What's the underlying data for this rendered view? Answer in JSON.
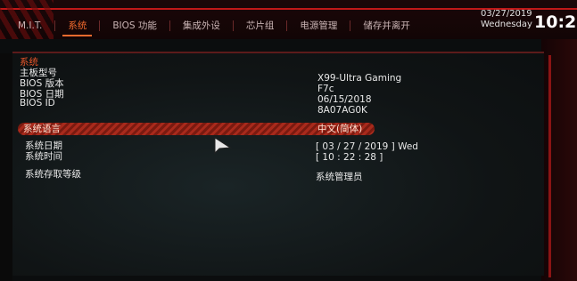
{
  "tabs": [
    {
      "label": "M.I.T."
    },
    {
      "label": "系统"
    },
    {
      "label": "BIOS 功能"
    },
    {
      "label": "集成外设"
    },
    {
      "label": "芯片组"
    },
    {
      "label": "电源管理"
    },
    {
      "label": "储存并离开"
    }
  ],
  "clock": {
    "date": "03/27/2019",
    "day": "Wednesday",
    "time": "10:2"
  },
  "system": {
    "section_title": "系统",
    "info": [
      {
        "label": "主板型号",
        "value": "X99-Ultra Gaming"
      },
      {
        "label": "BIOS 版本",
        "value": "F7c"
      },
      {
        "label": "BIOS 日期",
        "value": "06/15/2018"
      },
      {
        "label": "BIOS ID",
        "value": "8A07AG0K"
      }
    ],
    "language": {
      "label": "系统语言",
      "value": "中文(简体)"
    },
    "date": {
      "label": "系统日期",
      "value": "[ 03 / 27 / 2019 ]   Wed"
    },
    "time": {
      "label": "系统时间",
      "value": "[ 10 : 22 : 28 ]"
    },
    "access": {
      "label": "系统存取等级",
      "value": "系统管理员"
    }
  },
  "colors": {
    "accent": "#f26b2e",
    "frame": "#c01818",
    "highlight": "#a82a1c"
  }
}
